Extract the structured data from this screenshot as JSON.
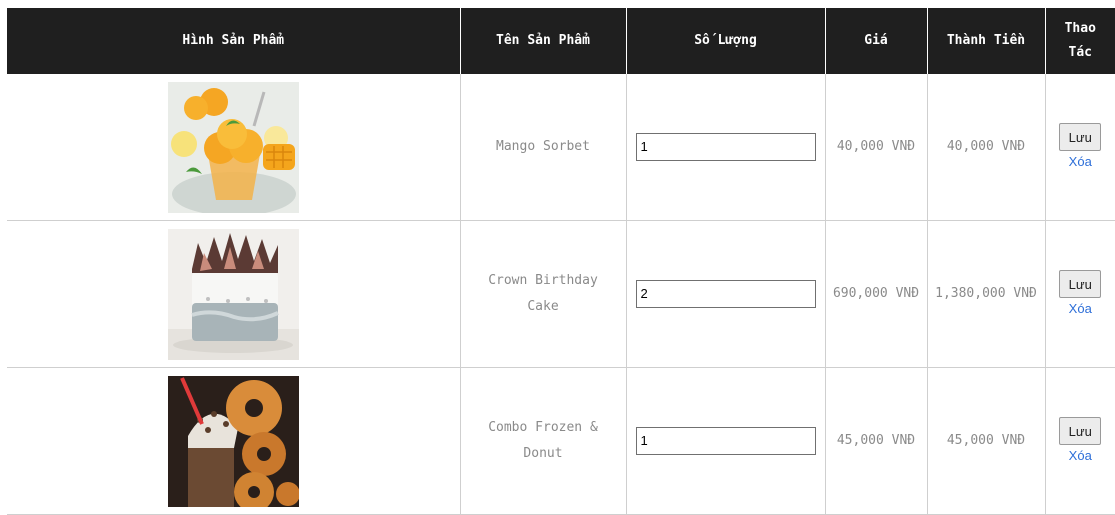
{
  "cart": {
    "headers": {
      "image": "Hình Sản Phẩm",
      "name": "Tên Sản Phẩm",
      "quantity": "Số Lượng",
      "price": "Giá",
      "total": "Thành Tiền",
      "action": "Thao Tác"
    },
    "save_label": "Lưu",
    "delete_label": "Xóa",
    "rows": [
      {
        "name": "Mango Sorbet",
        "quantity": "1",
        "price": "40,000 VNĐ",
        "total": "40,000 VNĐ",
        "image": "mango-sorbet-photo"
      },
      {
        "name": "Crown Birthday Cake",
        "quantity": "2",
        "price": "690,000 VNĐ",
        "total": "1,380,000 VNĐ",
        "image": "crown-cake-photo"
      },
      {
        "name": "Combo Frozen & Donut",
        "quantity": "1",
        "price": "45,000 VNĐ",
        "total": "45,000 VNĐ",
        "image": "frozen-donut-photo"
      }
    ]
  }
}
